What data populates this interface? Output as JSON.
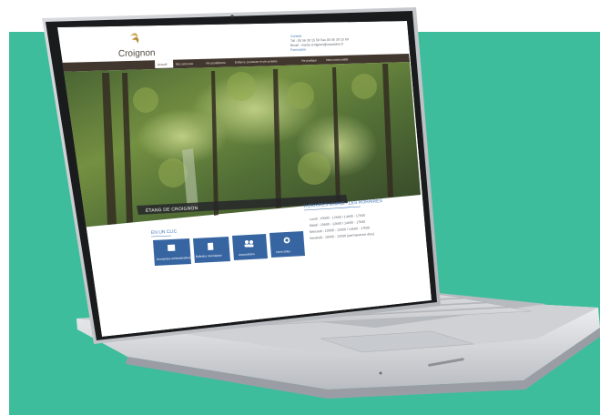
{
  "site": {
    "logo_text": "Croignon",
    "contact_title": "Contact",
    "contact_lines": [
      "Tél : 05 56 30 15 50  Fax 05 56 30 15 69",
      "Email : mairie.croignon@wanadoo.fr",
      "Formulaire"
    ]
  },
  "nav": {
    "items": [
      "Accueil",
      "Ma commune",
      "Vie quotidienne",
      "Enfance, jeunesse et vie scolaire",
      "Vie pratique",
      "Intercommunalité"
    ]
  },
  "hero": {
    "caption": "ÉTANG DE CROIGNON"
  },
  "quick_links": {
    "heading": "EN UN CLIC",
    "tiles": [
      {
        "label": "Demandes administratives",
        "icon": "calendar-icon"
      },
      {
        "label": "Bulletins municipaux",
        "icon": "document-icon"
      },
      {
        "label": "Associations",
        "icon": "people-icon"
      },
      {
        "label": "Liens utiles",
        "icon": "globe-icon"
      }
    ]
  },
  "hours": {
    "heading": "HORAIRES MAIRIE - LES HORAIRES",
    "lines": [
      "Lundi : 10h00 - 12h00 / 14h00 - 17h00",
      "Mardi : 10h00 - 12h00 / 14h00 - 17h00",
      "Mercredi : 10h00 - 12h00 / 14h00 - 17h00",
      "Vendredi : 10h00 - 12h00 (permanence élus)"
    ]
  },
  "colors": {
    "background": "#3dbd9c",
    "nav_bar": "#3b2f26",
    "tile_blue": "#2f5f9e",
    "accent_blue": "#3f74b3"
  }
}
